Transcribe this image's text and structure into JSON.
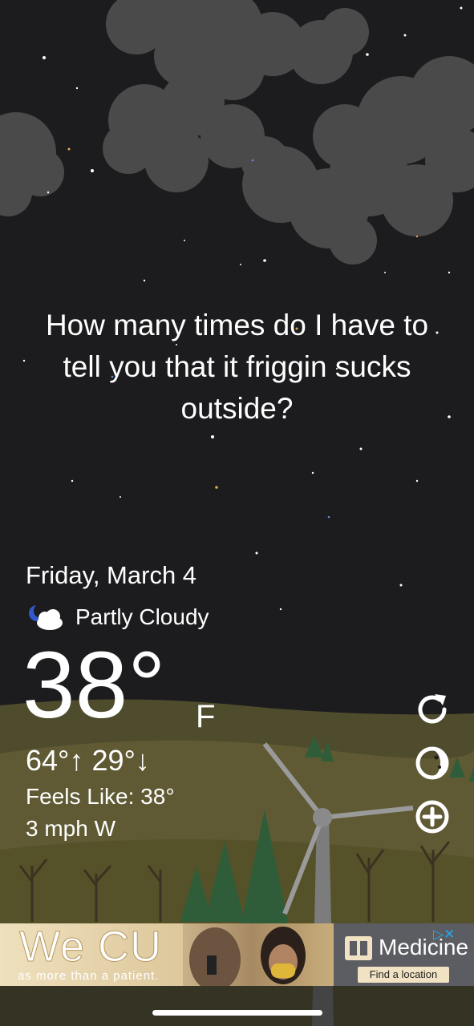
{
  "message": "How many times do I have to tell you that it friggin sucks outside?",
  "weather": {
    "date": "Friday, March 4",
    "condition": "Partly Cloudy",
    "condition_icon": "partly-cloudy-night-icon",
    "temperature": "38°",
    "unit": "F",
    "high_low": "64°↑  29°↓",
    "feels_like": "Feels Like: 38°",
    "wind": "3 mph W"
  },
  "controls": {
    "refresh_icon": "refresh-icon",
    "theme_icon": "moon-phase-icon",
    "add_icon": "add-circle-icon"
  },
  "ad": {
    "headline": "We CU",
    "subline": "as more than a patient.",
    "brand": "Medicine",
    "cta": "Find a location",
    "icons": "▷✕"
  },
  "colors": {
    "sky": "#1c1c1e",
    "cloud": "#4a4a4a",
    "hill": "#5f5a33",
    "tree": "#2f5d39"
  }
}
